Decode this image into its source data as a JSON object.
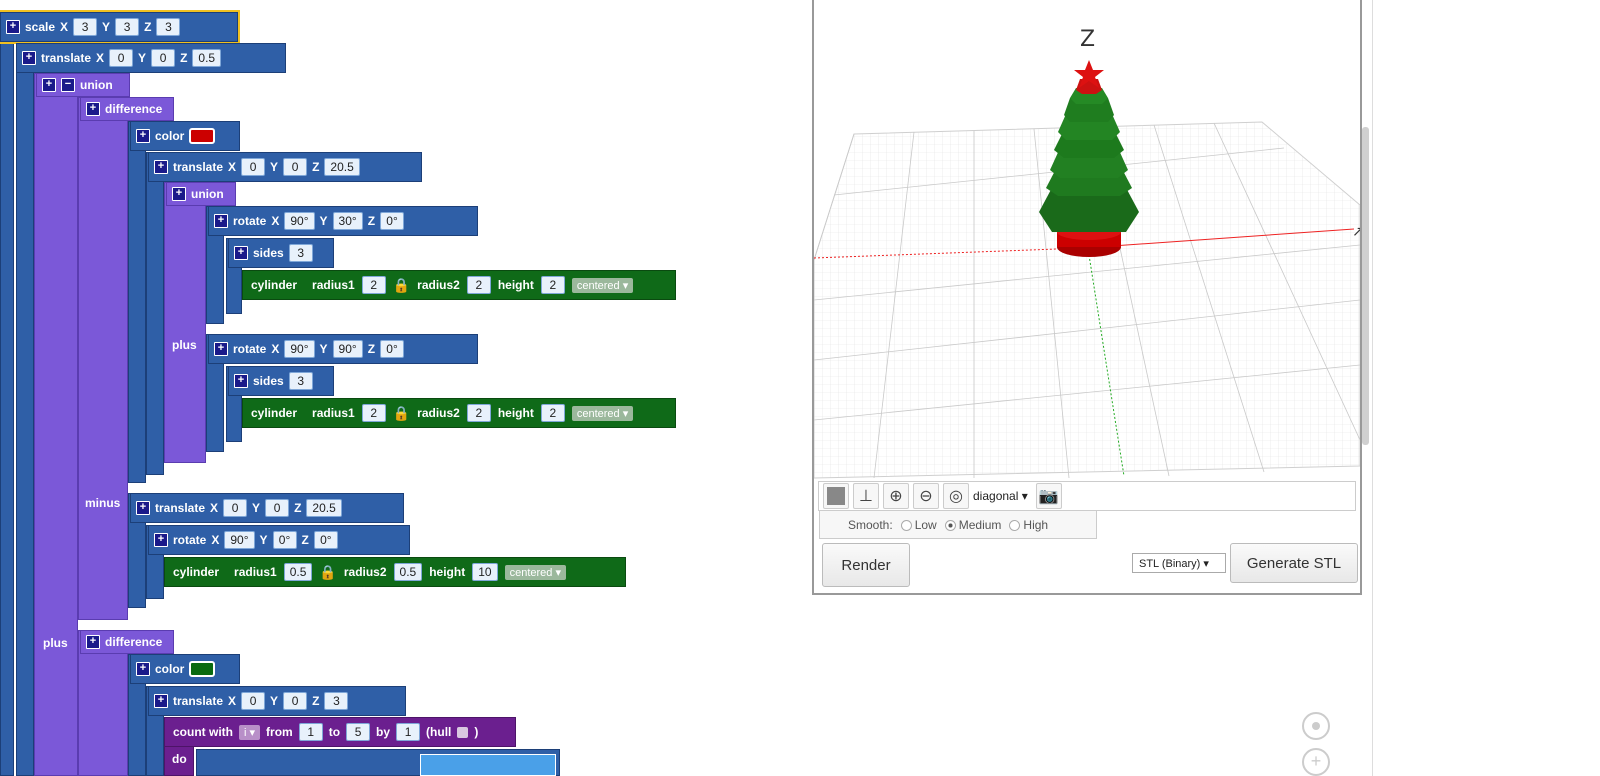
{
  "blocks": {
    "scale": {
      "label": "scale",
      "x": "3",
      "y": "3",
      "z": "3"
    },
    "translate1": {
      "label": "translate",
      "x": "0",
      "y": "0",
      "z": "0.5"
    },
    "union1": {
      "label": "union"
    },
    "difference1": {
      "label": "difference"
    },
    "color1": {
      "label": "color",
      "swatch": "#cc0000"
    },
    "translate2": {
      "label": "translate",
      "x": "0",
      "y": "0",
      "z": "20.5"
    },
    "union2": {
      "label": "union"
    },
    "rotate1": {
      "label": "rotate",
      "x": "90°",
      "y": "30°",
      "z": "0°"
    },
    "sides1": {
      "label": "sides",
      "value": "3"
    },
    "cylinder1": {
      "label": "cylinder",
      "radius1_label": "radius1",
      "radius1": "2",
      "radius2_label": "radius2",
      "radius2": "2",
      "height_label": "height",
      "height": "2",
      "mode": "centered ▾"
    },
    "plus_label": "plus",
    "rotate2": {
      "label": "rotate",
      "x": "90°",
      "y": "90°",
      "z": "0°"
    },
    "sides2": {
      "label": "sides",
      "value": "3"
    },
    "cylinder2": {
      "label": "cylinder",
      "radius1_label": "radius1",
      "radius1": "2",
      "radius2_label": "radius2",
      "radius2": "2",
      "height_label": "height",
      "height": "2",
      "mode": "centered ▾"
    },
    "minus_label": "minus",
    "translate3": {
      "label": "translate",
      "x": "0",
      "y": "0",
      "z": "20.5"
    },
    "rotate3": {
      "label": "rotate",
      "x": "90°",
      "y": "0°",
      "z": "0°"
    },
    "cylinder3": {
      "label": "cylinder",
      "radius1_label": "radius1",
      "radius1": "0.5",
      "radius2_label": "radius2",
      "radius2": "0.5",
      "height_label": "height",
      "height": "10",
      "mode": "centered ▾"
    },
    "plus2_label": "plus",
    "difference2": {
      "label": "difference"
    },
    "color2": {
      "label": "color",
      "swatch": "#0a6a10"
    },
    "translate4": {
      "label": "translate",
      "x": "0",
      "y": "0",
      "z": "3"
    },
    "countwith": {
      "label": "count with",
      "var": "i ▾",
      "from_label": "from",
      "from": "1",
      "to_label": "to",
      "to": "5",
      "by_label": "by",
      "by": "1",
      "hull_label": "(hull",
      "hull_end": ")"
    },
    "do_label": "do",
    "axis_x": "X",
    "axis_y": "Y",
    "axis_z": "Z"
  },
  "viewer": {
    "z_axis_label": "Z",
    "view_select": "diagonal ▾",
    "smooth_label": "Smooth:",
    "smooth_options": [
      "Low",
      "Medium",
      "High"
    ],
    "smooth_selected": "Medium",
    "render_button": "Render",
    "format_select": "STL (Binary) ▾",
    "generate_button": "Generate STL",
    "colors": {
      "red": "#cc0000",
      "green": "#1e7a1e",
      "grid": "#cfcfcf"
    }
  }
}
